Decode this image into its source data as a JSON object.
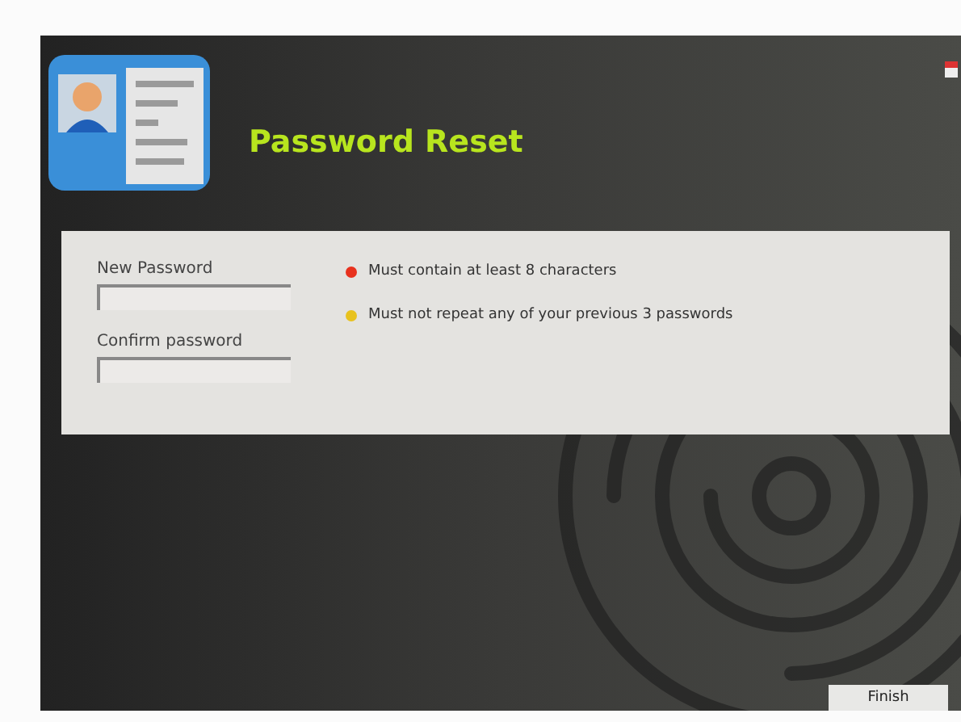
{
  "title": "Password Reset",
  "fields": [
    {
      "label": "New Password"
    },
    {
      "label": "Confirm password"
    }
  ],
  "rules": [
    {
      "text": "Must contain at least 8 characters",
      "color": "#e8321e"
    },
    {
      "text": "Must not repeat any of your previous 3 passwords",
      "color": "#e8c21e"
    }
  ],
  "buttons": [
    "Finish"
  ]
}
